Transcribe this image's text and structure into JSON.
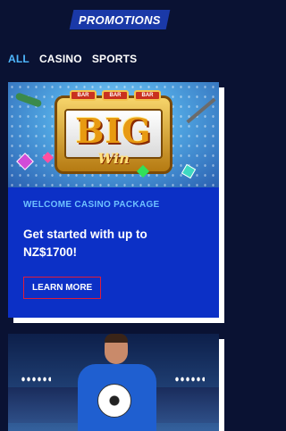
{
  "header": {
    "badge_label": "PROMOTIONS"
  },
  "filters": [
    {
      "label": "ALL",
      "active": true
    },
    {
      "label": "CASINO",
      "active": false
    },
    {
      "label": "SPORTS",
      "active": false
    }
  ],
  "promo1": {
    "image_slot_tabs": [
      "BAR",
      "BAR",
      "BAR"
    ],
    "image_big_text": "BIG",
    "image_win_text": "Win",
    "eyebrow": "WELCOME CASINO PACKAGE",
    "headline": "Get started with up to NZ$1700!",
    "cta_label": "LEARN MORE"
  },
  "colors": {
    "background": "#0a1233",
    "card": "#0c30c6",
    "accent": "#4fb8ff",
    "cta_border": "#e01c3a"
  }
}
